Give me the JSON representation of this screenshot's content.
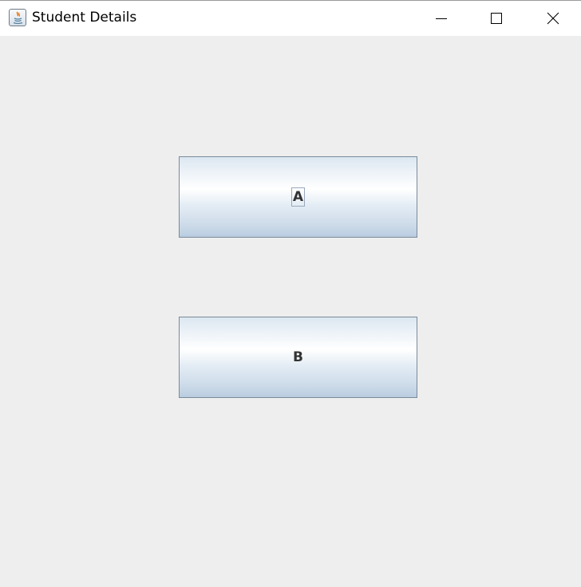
{
  "window": {
    "title": "Student Details",
    "icon": "java-icon",
    "controls": {
      "minimize_icon": "minimize-icon",
      "maximize_icon": "maximize-icon",
      "close_icon": "close-icon"
    }
  },
  "buttons": [
    {
      "label": "A",
      "focused": true
    },
    {
      "label": "B",
      "focused": false
    }
  ],
  "colors": {
    "window_background": "#eeeeee",
    "titlebar_background": "#ffffff",
    "button_border": "#7a8a99",
    "button_text": "#333333"
  }
}
